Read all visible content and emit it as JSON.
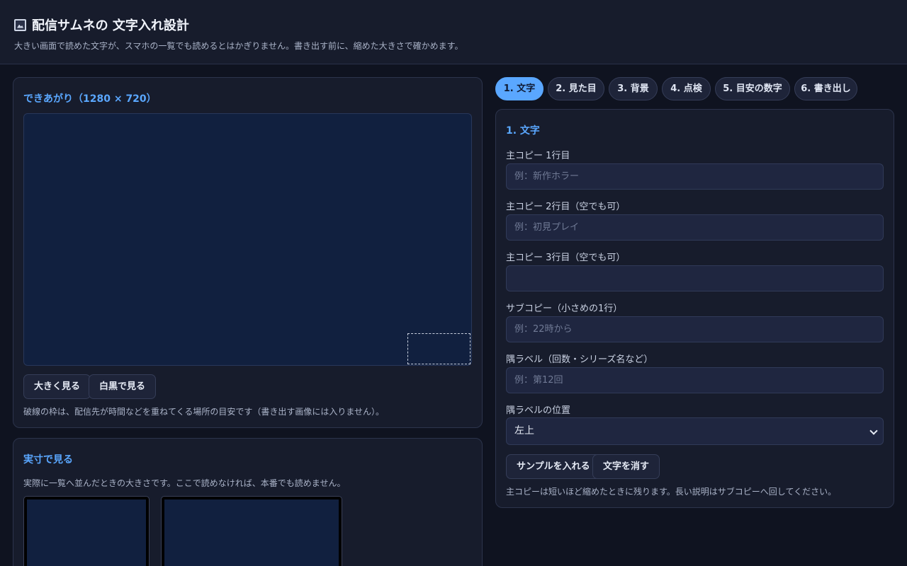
{
  "header": {
    "title": "配信サムネの 文字入れ設計",
    "subtitle": "大きい画面で読めた文字が、スマホの一覧でも読めるとはかぎりません。書き出す前に、縮めた大きさで確かめます。",
    "icon": "image-icon"
  },
  "preview_card": {
    "title": "できあがり（1280 × 720）",
    "buttons": {
      "zoom": "大きく見る",
      "grayscale": "白黒で見る"
    },
    "note": "破線の枠は、配信先が時間などを重ねてくる場所の目安です（書き出す画像には入りません）。"
  },
  "actual_card": {
    "title": "実寸で見る",
    "note": "実際に一覧へ並んだときの大きさです。ここで読めなければ、本番でも読めません。"
  },
  "tabs": [
    {
      "label": "1. 文字",
      "active": true
    },
    {
      "label": "2. 見た目",
      "active": false
    },
    {
      "label": "3. 背景",
      "active": false
    },
    {
      "label": "4. 点検",
      "active": false
    },
    {
      "label": "5. 目安の数字",
      "active": false
    },
    {
      "label": "6. 書き出し",
      "active": false
    }
  ],
  "form": {
    "title": "1. 文字",
    "fields": [
      {
        "label": "主コピー 1行目",
        "placeholder": "例：新作ホラー",
        "value": ""
      },
      {
        "label": "主コピー 2行目（空でも可）",
        "placeholder": "例：初見プレイ",
        "value": ""
      },
      {
        "label": "主コピー 3行目（空でも可）",
        "placeholder": "",
        "value": ""
      },
      {
        "label": "サブコピー（小さめの1行）",
        "placeholder": "例：22時から",
        "value": ""
      },
      {
        "label": "隅ラベル（回数・シリーズ名など）",
        "placeholder": "例：第12回",
        "value": ""
      }
    ],
    "position_label": "隅ラベルの位置",
    "position_value": "左上",
    "buttons": {
      "sample": "サンプルを入れる",
      "clear": "文字を消す"
    },
    "note": "主コピーは短いほど縮めたときに残ります。長い説明はサブコピーへ回してください。"
  }
}
